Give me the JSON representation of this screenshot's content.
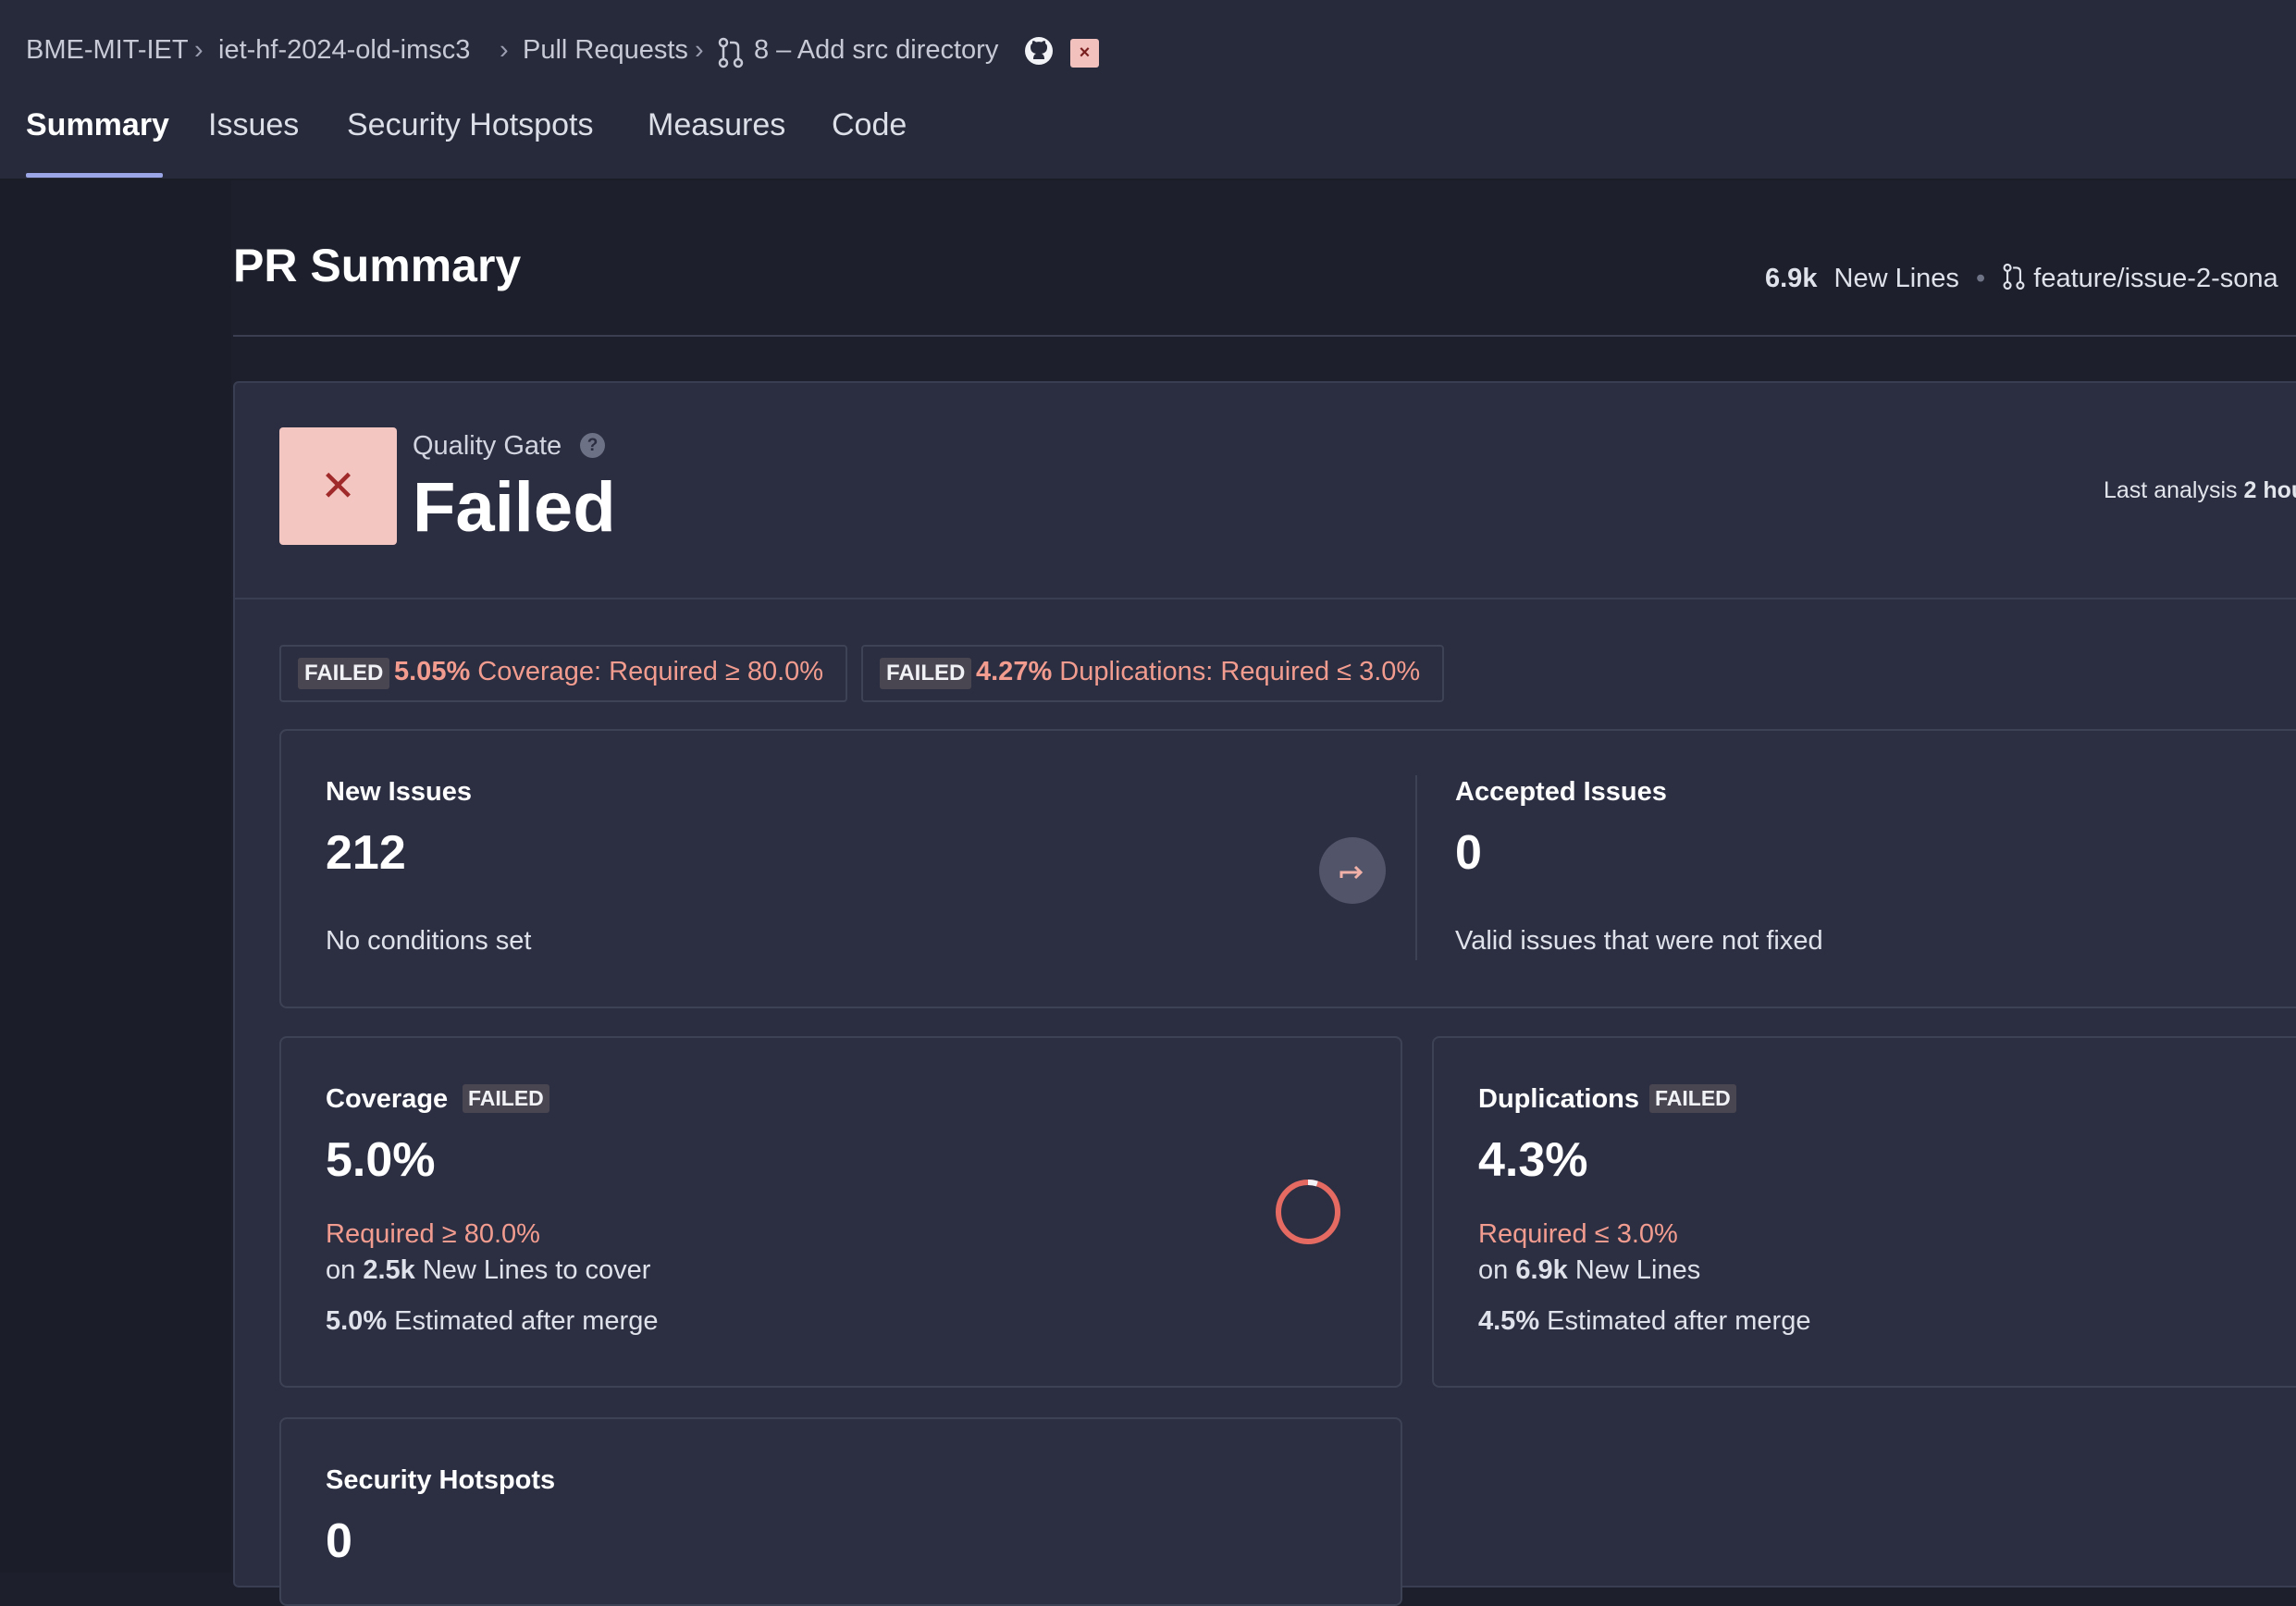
{
  "breadcrumb": {
    "org": "BME-MIT-IET",
    "project": "iet-hf-2024-old-imsc3",
    "section": "Pull Requests",
    "pr": "8 – Add src directory"
  },
  "tabs": [
    "Summary",
    "Issues",
    "Security Hotspots",
    "Measures",
    "Code"
  ],
  "page": {
    "title": "PR Summary",
    "new_lines_value": "6.9k",
    "new_lines_label": "New Lines",
    "bullet": "•",
    "branch": "feature/issue-2-sona"
  },
  "quality_gate": {
    "label": "Quality Gate",
    "status": "Failed",
    "last_analysis_label": "Last analysis",
    "last_analysis_value": "2 hou"
  },
  "conditions": [
    {
      "tag": "FAILED",
      "value": "5.05%",
      "text": "Coverage: Required ≥ 80.0%"
    },
    {
      "tag": "FAILED",
      "value": "4.27%",
      "text": "Duplications: Required ≤ 3.0%"
    }
  ],
  "new_issues": {
    "title": "New Issues",
    "value": "212",
    "sub": "No conditions set"
  },
  "accepted_issues": {
    "title": "Accepted Issues",
    "value": "0",
    "sub": "Valid issues that were not fixed"
  },
  "coverage": {
    "title": "Coverage",
    "tag": "FAILED",
    "value": "5.0%",
    "required": "Required ≥ 80.0%",
    "on_prefix": "on",
    "lines": "2.5k",
    "lines_suffix": "New Lines to cover",
    "estimate": "5.0%",
    "estimate_suffix": "Estimated after merge",
    "gauge_fraction": 0.05
  },
  "duplications": {
    "title": "Duplications",
    "tag": "FAILED",
    "value": "4.3%",
    "required": "Required ≤ 3.0%",
    "on_prefix": "on",
    "lines": "6.9k",
    "lines_suffix": "New Lines",
    "estimate": "4.5%",
    "estimate_suffix": "Estimated after merge"
  },
  "hotspots": {
    "title": "Security Hotspots",
    "value": "0"
  },
  "colors": {
    "failed": "#f29c8f",
    "accent": "#9aa6e6",
    "background": "#1d202c"
  },
  "icons": {
    "pr": "pull-request-icon",
    "github": "github-icon",
    "help": "help-icon",
    "jump": "arrow-jump-icon"
  }
}
